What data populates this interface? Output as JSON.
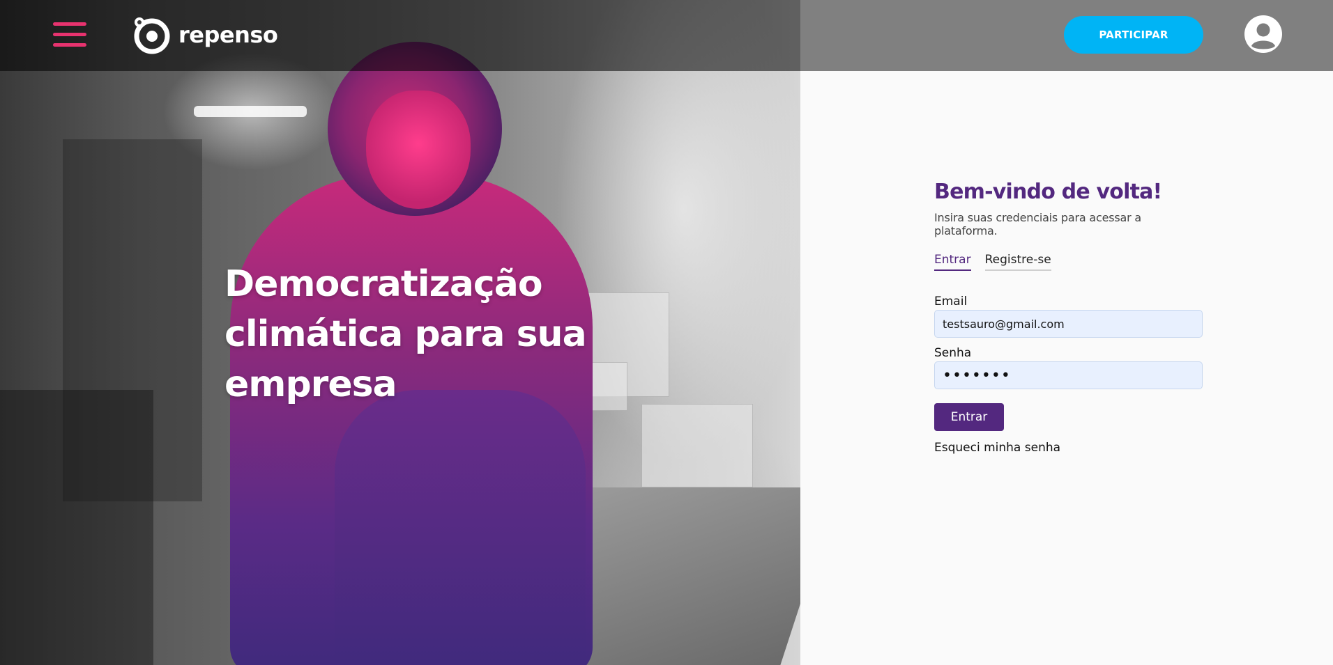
{
  "header": {
    "brand": "repenso",
    "join_label": "PARTICIPAR"
  },
  "hero": {
    "title": "Democratização climática para sua empresa"
  },
  "login": {
    "title": "Bem-vindo de volta!",
    "subtitle": "Insira suas credenciais para acessar a plataforma.",
    "tabs": [
      {
        "label": "Entrar",
        "active": true
      },
      {
        "label": "Registre-se",
        "active": false
      }
    ],
    "email_label": "Email",
    "email_value": "testsauro@gmail.com",
    "password_label": "Senha",
    "password_value": "•••••••",
    "submit_label": "Entrar",
    "forgot_label": "Esqueci minha senha"
  },
  "colors": {
    "accent_purple": "#53287f",
    "accent_pink": "#e8336f",
    "button_blue": "#00b4f5"
  },
  "icons": {
    "menu": "hamburger-menu-icon",
    "logo": "repenso-logo-icon",
    "user": "user-avatar-icon"
  }
}
